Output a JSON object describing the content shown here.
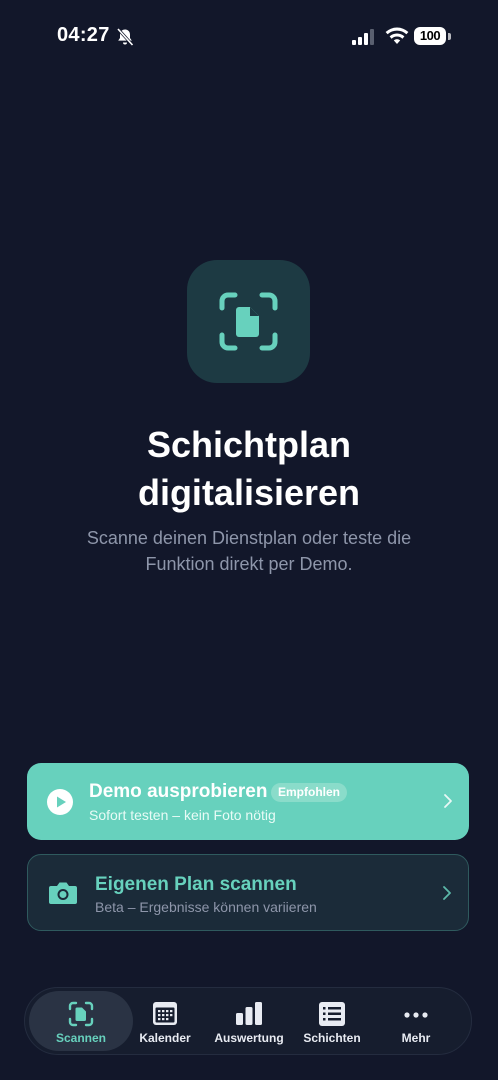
{
  "status_bar": {
    "time": "04:27",
    "battery": "100",
    "icons": [
      "bell-muted-icon",
      "signal-icon",
      "wifi-icon",
      "battery-icon"
    ]
  },
  "hero": {
    "icon": "document-scan-icon",
    "title": "Schichtplan\ndigitalisieren",
    "subtitle": "Scanne deinen Dienstplan oder teste die Funktion direkt per Demo."
  },
  "cards": {
    "demo": {
      "icon": "play-circle-icon",
      "title": "Demo ausprobieren",
      "badge": "Empfohlen",
      "subtitle": "Sofort testen – kein Foto nötig"
    },
    "scan": {
      "icon": "camera-icon",
      "title": "Eigenen Plan scannen",
      "subtitle": "Beta – Ergebnisse können variieren"
    }
  },
  "tabs": [
    {
      "label": "Scannen",
      "icon": "document-scan-icon",
      "active": true
    },
    {
      "label": "Kalender",
      "icon": "calendar-icon",
      "active": false
    },
    {
      "label": "Auswertung",
      "icon": "bar-chart-icon",
      "active": false
    },
    {
      "label": "Schichten",
      "icon": "list-icon",
      "active": false
    },
    {
      "label": "Mehr",
      "icon": "more-icon",
      "active": false
    }
  ],
  "colors": {
    "background": "#12172a",
    "accent": "#67d1bd",
    "card_dark": "#1b2b39",
    "muted_text": "#8e96aa"
  }
}
